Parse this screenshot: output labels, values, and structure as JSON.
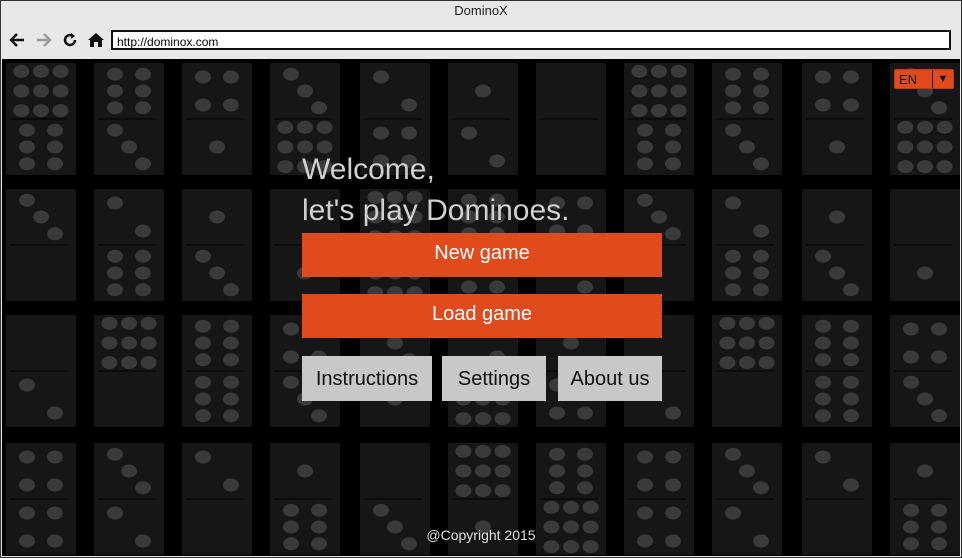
{
  "window": {
    "title": "DominoX"
  },
  "browser": {
    "url": "http://dominox.com",
    "back_icon": "arrow-left-icon",
    "forward_icon": "arrow-right-icon",
    "reload_icon": "reload-icon",
    "home_icon": "home-icon"
  },
  "language_selector": {
    "value": "EN",
    "arrow": "▼"
  },
  "welcome": {
    "line1": "Welcome,",
    "line2": "let's play Dominoes."
  },
  "buttons": {
    "new_game": "New game",
    "load_game": "Load game",
    "instructions": "Instructions",
    "settings": "Settings",
    "about_us": "About us"
  },
  "footer": {
    "copyright": "@Copyright 2015"
  },
  "colors": {
    "accent": "#e04a1c",
    "secondary_button": "#c8c8c8",
    "background": "#000000",
    "tile": "#161616",
    "pip": "#3a3a3a"
  }
}
